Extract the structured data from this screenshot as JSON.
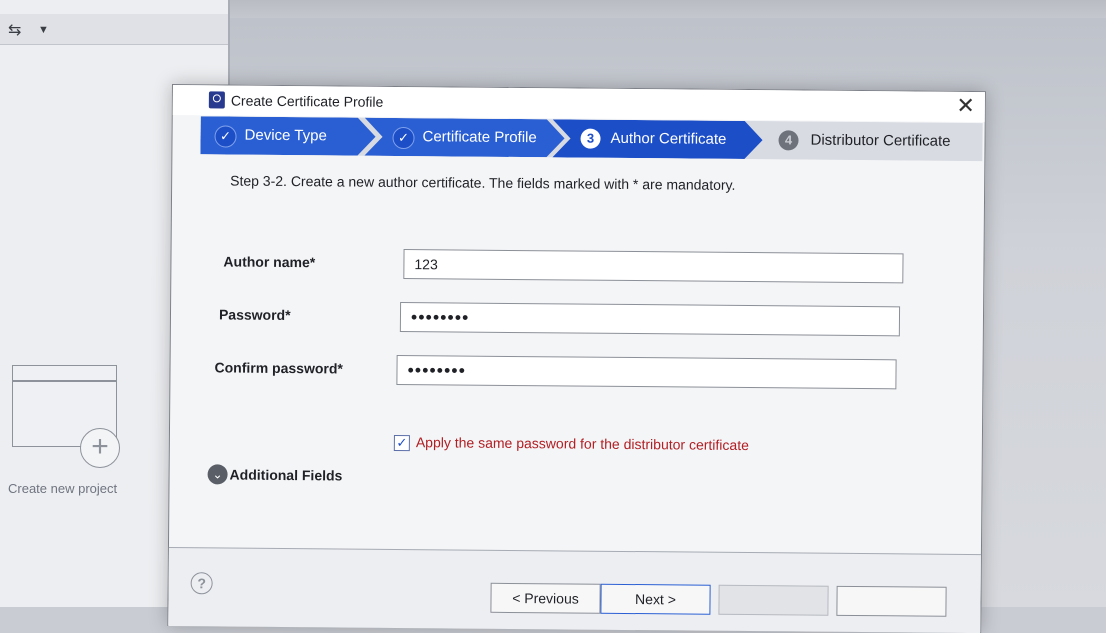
{
  "background": {
    "new_project_label": "Create new project"
  },
  "dialog": {
    "title": "Create Certificate Profile",
    "steps": [
      {
        "label": "Device Type",
        "badge": "✓",
        "state": "done"
      },
      {
        "label": "Certificate Profile",
        "badge": "✓",
        "state": "done"
      },
      {
        "label": "Author Certificate",
        "badge": "3",
        "state": "active"
      },
      {
        "label": "Distributor Certificate",
        "badge": "4",
        "state": "pending"
      }
    ],
    "step_description": "Step 3-2. Create a new author certificate. The fields marked with * are mandatory.",
    "fields": {
      "author_name": {
        "label": "Author name*",
        "value": "123"
      },
      "password": {
        "label": "Password*",
        "value": "••••••••"
      },
      "confirm_password": {
        "label": "Confirm password*",
        "value": "••••••••"
      }
    },
    "apply_same_password": {
      "label": "Apply the same password for the distributor certificate",
      "checked": true
    },
    "additional_fields_label": "Additional Fields",
    "buttons": {
      "previous": "< Previous",
      "next": "Next >",
      "finish": "",
      "cancel": ""
    }
  },
  "colors": {
    "step_done": "#2a5fd3",
    "step_active": "#1c4ec8",
    "checkbox_label": "#b11f24"
  }
}
